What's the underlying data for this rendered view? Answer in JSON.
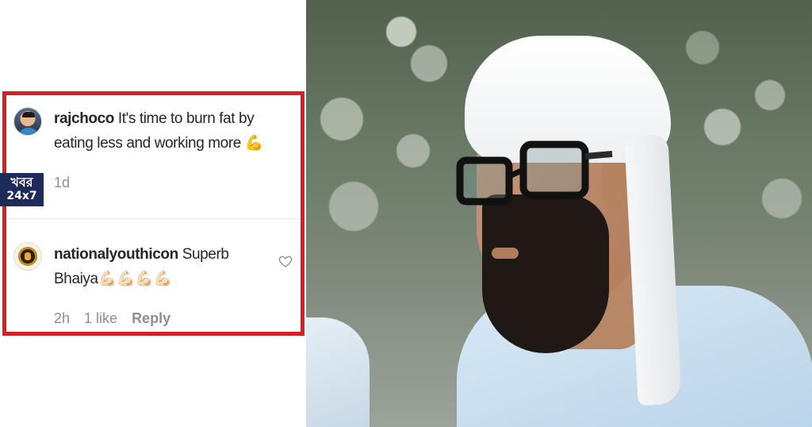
{
  "comments": [
    {
      "username": "rajchoco",
      "text": "It's time to burn fat by eating less and working more 💪",
      "time": "1d",
      "avatar_icon": "user-avatar"
    },
    {
      "username": "nationalyouthicon",
      "text": "Superb Bhaiya💪🏻💪🏻💪🏻💪🏻",
      "time": "2h",
      "likes": "1 like",
      "reply_label": "Reply",
      "avatar_icon": "emblem-avatar",
      "like_icon": "heart-icon"
    }
  ],
  "watermark": {
    "line1": "খবর",
    "line2": "24x7"
  },
  "colors": {
    "highlight_border": "#d71f25",
    "badge_bg": "#1d2a5a",
    "meta_text": "#8e8e8e"
  },
  "photo": {
    "description_icon": "man-with-white-headscarf-photo"
  }
}
